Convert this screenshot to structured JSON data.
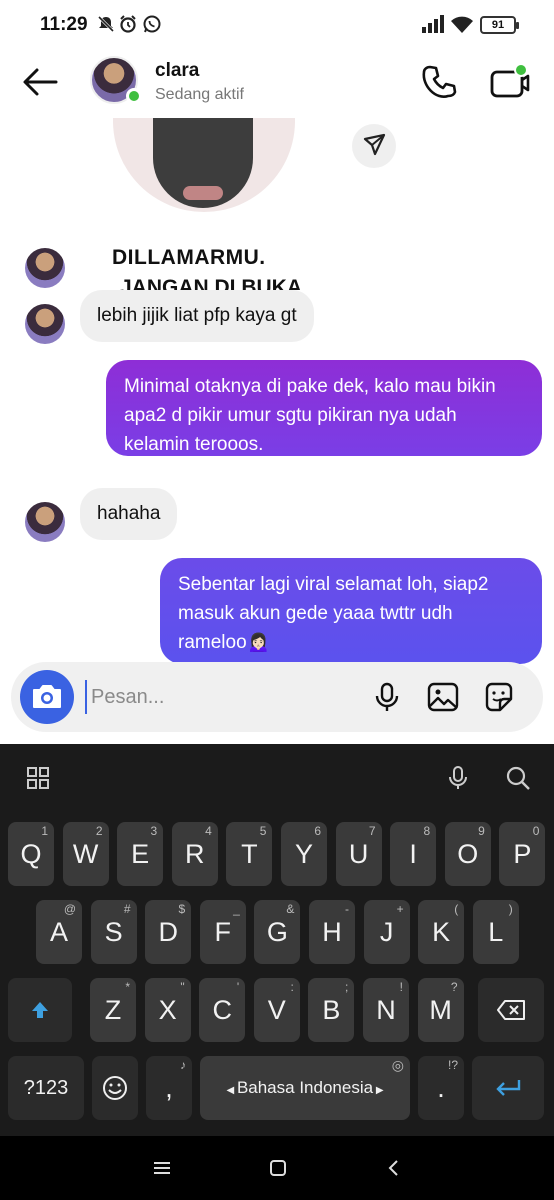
{
  "status_bar": {
    "time": "11:29",
    "battery": "91"
  },
  "header": {
    "name": "clara",
    "status": "Sedang aktif"
  },
  "shared_post": {
    "line1": "DILLAMARMU.",
    "line2": "JANGAN DI BUKA"
  },
  "messages": [
    {
      "direction": "in",
      "text": "lebih jijik liat pfp kaya gt"
    },
    {
      "direction": "out",
      "text": "Minimal otaknya di pake dek, kalo mau bikin apa2 d pikir umur sgtu pikiran nya udah kelamin terooos."
    },
    {
      "direction": "in",
      "text": "hahaha"
    },
    {
      "direction": "out",
      "text": "Sebentar lagi viral selamat loh, siap2 masuk akun gede yaaa twttr udh rameloo🙍🏻‍♀️"
    }
  ],
  "composer": {
    "placeholder": "Pesan..."
  },
  "keyboard": {
    "row1": [
      {
        "k": "Q",
        "h": "1"
      },
      {
        "k": "W",
        "h": "2"
      },
      {
        "k": "E",
        "h": "3"
      },
      {
        "k": "R",
        "h": "4"
      },
      {
        "k": "T",
        "h": "5"
      },
      {
        "k": "Y",
        "h": "6"
      },
      {
        "k": "U",
        "h": "7"
      },
      {
        "k": "I",
        "h": "8"
      },
      {
        "k": "O",
        "h": "9"
      },
      {
        "k": "P",
        "h": "0"
      }
    ],
    "row2": [
      {
        "k": "A",
        "h": "@"
      },
      {
        "k": "S",
        "h": "#"
      },
      {
        "k": "D",
        "h": "$"
      },
      {
        "k": "F",
        "h": "_"
      },
      {
        "k": "G",
        "h": "&"
      },
      {
        "k": "H",
        "h": "-"
      },
      {
        "k": "J",
        "h": "+"
      },
      {
        "k": "K",
        "h": "("
      },
      {
        "k": "L",
        "h": ")"
      }
    ],
    "row3": [
      {
        "k": "Z",
        "h": "*"
      },
      {
        "k": "X",
        "h": "\""
      },
      {
        "k": "C",
        "h": "'"
      },
      {
        "k": "V",
        "h": ":"
      },
      {
        "k": "B",
        "h": ";"
      },
      {
        "k": "N",
        "h": "!"
      },
      {
        "k": "M",
        "h": "?"
      }
    ],
    "symbols": "?123",
    "comma": ",",
    "space": "Bahasa Indonesia",
    "period": ".",
    "period_hint": "!?"
  },
  "colors": {
    "accent": "#3a62e2",
    "outgoing_1": "#8e2ed6",
    "outgoing_2": "#6b4ce9",
    "online": "#3fbf3f"
  }
}
